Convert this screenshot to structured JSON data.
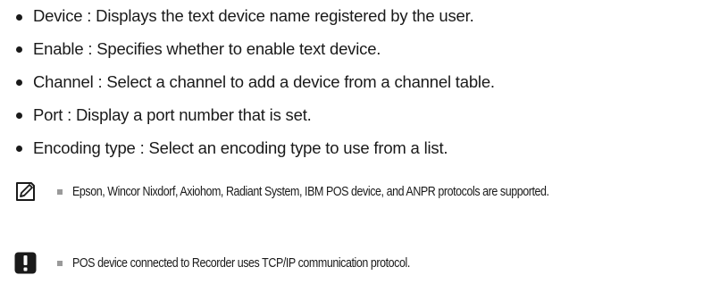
{
  "bullets": [
    {
      "text": "Device : Displays the text device name registered by the user."
    },
    {
      "text": "Enable : Specifies whether to enable text device."
    },
    {
      "text": "Channel : Select a channel to add a device from a channel table."
    },
    {
      "text": "Port : Display a port number that is set."
    },
    {
      "text": "Encoding type : Select an encoding type to use from a list."
    }
  ],
  "notes": {
    "memo": {
      "icon": "memo-pencil-icon",
      "text": "Epson, Wincor Nixdorf, Axiohom, Radiant System, IBM POS device, and ANPR protocols are supported."
    },
    "caution": {
      "icon": "caution-exclamation-icon",
      "text": "POS device connected to Recorder uses TCP/IP communication protocol."
    }
  },
  "colors": {
    "text": "#1a1a1a",
    "note_square": "#9a9a9a"
  }
}
